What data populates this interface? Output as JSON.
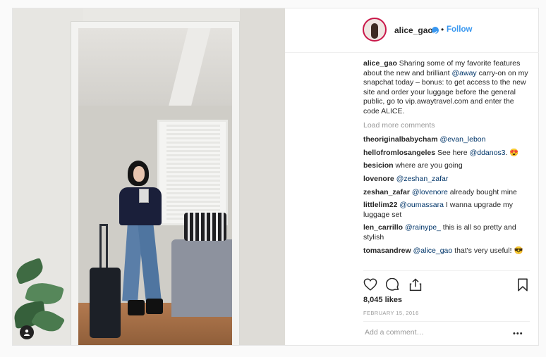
{
  "post": {
    "username": "alice_gao",
    "follow_label": "Follow",
    "separator": "•",
    "caption_user": "alice_gao",
    "caption_part1": " Sharing some of my favorite features about the new and brilliant ",
    "caption_mention": "@away",
    "caption_part2": " carry-on on my snapchat today – bonus: to get access to the new site and order your luggage before the general public, go to vip.awaytravel.com and enter the code ALICE.",
    "load_more": "Load more comments",
    "comments": [
      {
        "user": "theoriginalbabycham",
        "mention": "@evan_lebon",
        "text": ""
      },
      {
        "user": "hellofromlosangeles",
        "text_pre": "See here ",
        "mention": "@ddanos3",
        "text": ". 😍"
      },
      {
        "user": "besicion",
        "mention": "",
        "text": "where are you going"
      },
      {
        "user": "lovenore",
        "mention": "@zeshan_zafar",
        "text": ""
      },
      {
        "user": "zeshan_zafar",
        "mention": "@lovenore",
        "text": " already bought mine"
      },
      {
        "user": "littlelim22",
        "mention": "@oumassara",
        "text": " I wanna upgrade my luggage set"
      },
      {
        "user": "len_carrillo",
        "mention": "@rainype_",
        "text": " this is all so pretty and stylish"
      },
      {
        "user": "tomasandrew",
        "mention": "@alice_gao",
        "text": " that's very useful! 😎"
      }
    ],
    "likes": "8,045 likes",
    "date": "FEBRUARY 15, 2016",
    "add_comment_placeholder": "Add a comment…",
    "more_options": "•••"
  },
  "icons": [
    "heart-icon",
    "comment-icon",
    "share-icon",
    "bookmark-icon",
    "verified-icon",
    "tag-user-icon"
  ],
  "colors": {
    "link": "#3897f0",
    "mention": "#003569",
    "muted": "#999999",
    "text": "#262626"
  }
}
